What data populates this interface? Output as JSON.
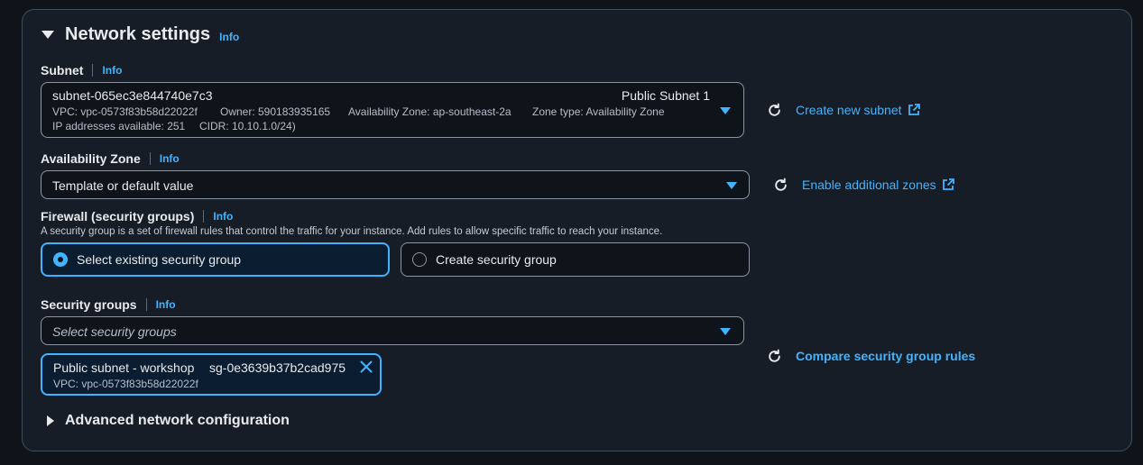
{
  "section": {
    "title": "Network settings",
    "info": "Info"
  },
  "subnet": {
    "label": "Subnet",
    "info": "Info",
    "id": "subnet-065ec3e844740e7c3",
    "name": "Public Subnet 1",
    "vpc": "VPC: vpc-0573f83b58d22022f",
    "owner": "Owner: 590183935165",
    "az": "Availability Zone: ap-southeast-2a",
    "zone_type": "Zone type: Availability Zone",
    "ips": "IP addresses available: 251",
    "cidr": "CIDR: 10.10.1.0/24)",
    "create_link": "Create new subnet"
  },
  "availability_zone": {
    "label": "Availability Zone",
    "info": "Info",
    "value": "Template or default value",
    "enable_link": "Enable additional zones"
  },
  "firewall": {
    "label": "Firewall (security groups)",
    "info": "Info",
    "description": "A security group is a set of firewall rules that control the traffic for your instance. Add rules to allow specific traffic to reach your instance.",
    "option_existing": "Select existing security group",
    "option_create": "Create security group",
    "selected": "existing"
  },
  "security_groups": {
    "label": "Security groups",
    "info": "Info",
    "placeholder": "Select security groups",
    "compare_link": "Compare security group rules",
    "token": {
      "name": "Public subnet - workshop",
      "id": "sg-0e3639b37b2cad975",
      "vpc": "VPC: vpc-0573f83b58d22022f"
    }
  },
  "advanced": {
    "label": "Advanced network configuration"
  },
  "colors": {
    "accent": "#42b4ff",
    "background": "#0f141a",
    "panel": "#161d26"
  }
}
